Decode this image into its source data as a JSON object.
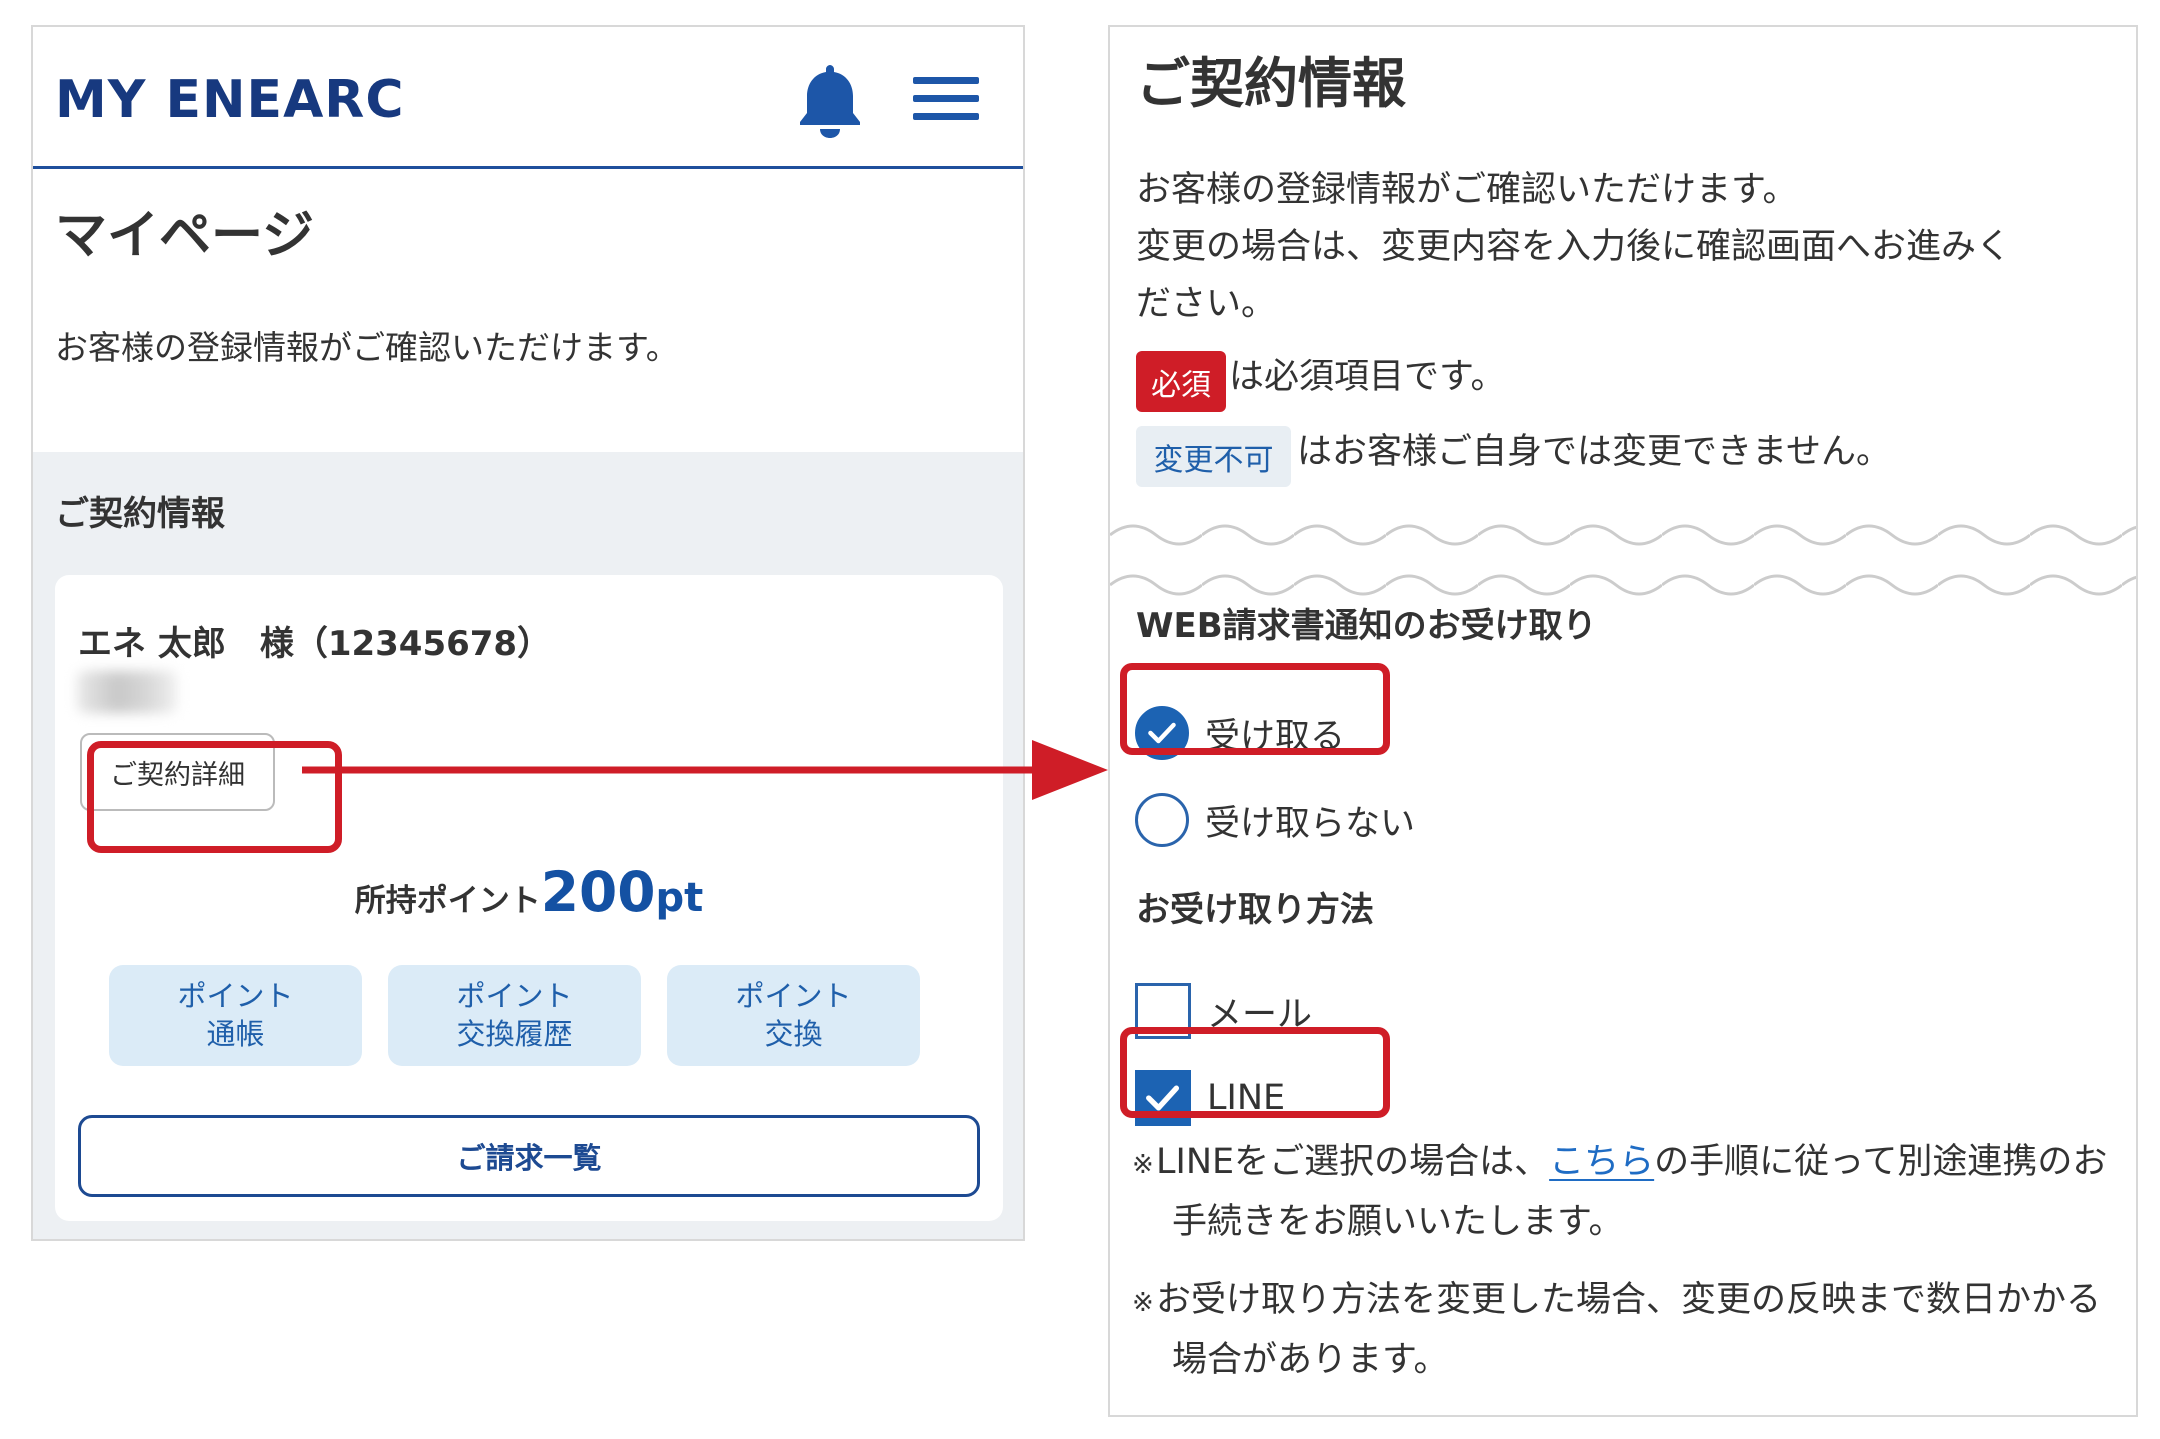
{
  "left_screen": {
    "header": {
      "logo_text": "MY ENEARC",
      "bell_icon": "bell-icon",
      "menu_icon": "hamburger-menu-icon"
    },
    "page_title": "マイページ",
    "intro": "お客様の登録情報がご確認いただけます。",
    "contract_section": {
      "heading": "ご契約情報",
      "customer_name": "エネ 太郎　様（12345678）",
      "detail_button": "ご契約詳細",
      "points": {
        "label": "所持ポイント",
        "value": "200",
        "unit": "pt"
      },
      "point_buttons": [
        {
          "line1": "ポイント",
          "line2": "通帳"
        },
        {
          "line1": "ポイント",
          "line2": "交換履歴"
        },
        {
          "line1": "ポイント",
          "line2": "交換"
        }
      ],
      "billing_button": "ご請求一覧"
    }
  },
  "right_screen": {
    "title": "ご契約情報",
    "intro_lines": [
      "お客様の登録情報がご確認いただけます。",
      "変更の場合は、変更内容を入力後に確認画面へお進みく",
      "ださい。"
    ],
    "required_badge": "必須",
    "required_note": "は必須項目です。",
    "immutable_badge": "変更不可",
    "immutable_note": "はお客様ご自身では変更できません。",
    "web_invoice": {
      "heading": "WEB請求書通知のお受け取り",
      "options": [
        {
          "label": "受け取る",
          "selected": true
        },
        {
          "label": "受け取らない",
          "selected": false
        }
      ]
    },
    "method": {
      "heading": "お受け取り方法",
      "options": [
        {
          "label": "メール",
          "checked": false
        },
        {
          "label": "LINE",
          "checked": true
        }
      ]
    },
    "notes": {
      "mark": "※",
      "line_note_before": "LINEをご選択の場合は、",
      "line_note_link": "こちら",
      "line_note_after": "の手順に従って別途連携のお手続きをお願いいたします。",
      "change_note": "お受け取り方法を変更した場合、変更の反映まで数日かかる場合があります。"
    }
  },
  "colors": {
    "brand_navy": "#17397f",
    "accent_blue": "#1c63b3",
    "highlight_red": "#cf1d27",
    "panel_gray": "#edf0f3",
    "point_button_bg": "#dbebf7"
  }
}
